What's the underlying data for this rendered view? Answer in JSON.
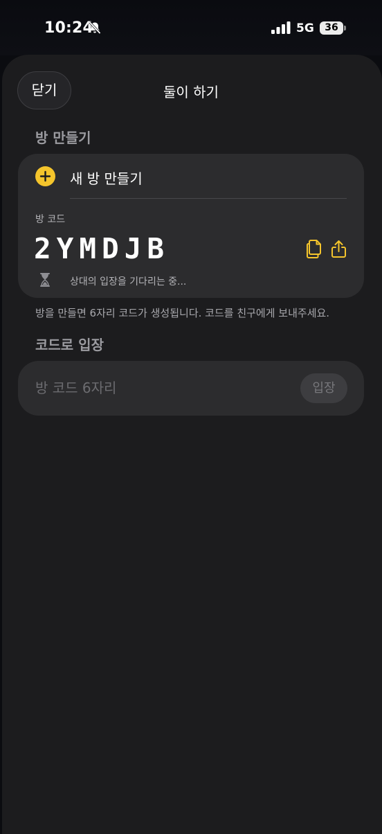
{
  "status_bar": {
    "time": "10:24",
    "network": "5G",
    "battery": "36",
    "silent_icon": "bell-slash-icon",
    "signal_icon": "cellular-signal-icon"
  },
  "header": {
    "close_label": "닫기",
    "title": "둘이 하기"
  },
  "create_section": {
    "label": "방 만들기",
    "new_room_label": "새 방 만들기",
    "new_room_icon": "plus-circle-icon",
    "code_caption": "방 코드",
    "room_code": "2YMDJB",
    "copy_icon": "copy-icon",
    "share_icon": "share-icon",
    "waiting_icon": "hourglass-icon",
    "waiting_text": "상대의 입장을 기다리는 중...",
    "help_text": "방을 만들면 6자리 코드가 생성됩니다. 코드를 친구에게 보내주세요."
  },
  "join_section": {
    "label": "코드로 입장",
    "input_value": "",
    "input_placeholder": "방 코드 6자리",
    "join_label": "입장"
  },
  "colors": {
    "accent": "#f5c52c",
    "background": "#1c1c1e",
    "card": "#2c2c2e"
  }
}
